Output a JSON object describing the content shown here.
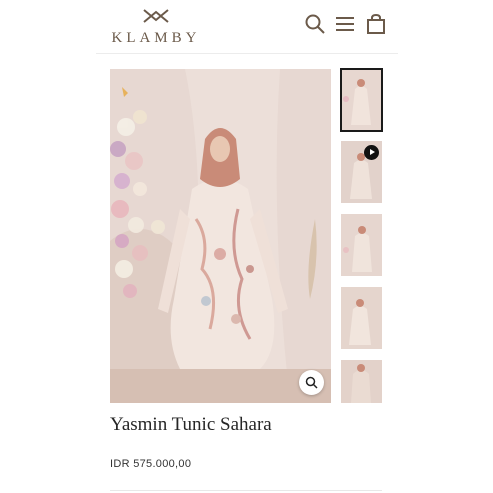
{
  "header": {
    "brand": "KLAMBY",
    "icons": [
      "search-icon",
      "menu-icon",
      "cart-icon"
    ]
  },
  "product": {
    "title": "Yasmin Tunic Sahara",
    "price": "IDR 575.000,00"
  },
  "gallery": {
    "thumbnail_count": 5,
    "active_thumbnail": 1,
    "video_thumbnail": 2
  },
  "colors": {
    "brand": "#6b5a4a",
    "background": "#ffffff",
    "backdrop": "#e6d6d0"
  }
}
